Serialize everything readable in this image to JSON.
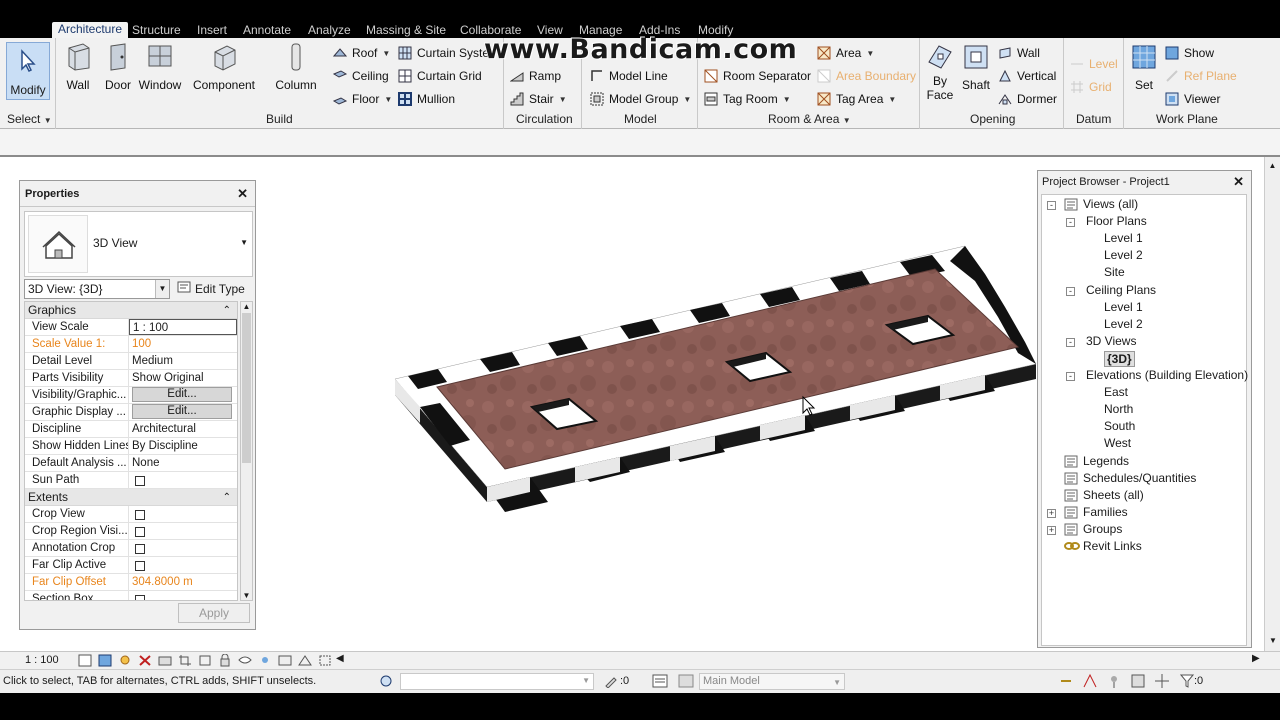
{
  "tabs": [
    "Architecture",
    "Structure",
    "Insert",
    "Annotate",
    "Analyze",
    "Massing & Site",
    "Collaborate",
    "View",
    "Manage",
    "Add-Ins",
    "Modify"
  ],
  "watermark": "www.Bandicam.com",
  "ribbon": {
    "modify": "Modify",
    "select": "Select",
    "build": {
      "label": "Build",
      "wall": "Wall",
      "door": "Door",
      "window": "Window",
      "component": "Component",
      "column": "Column",
      "roof": "Roof",
      "ceiling": "Ceiling",
      "floor": "Floor",
      "curtain_system": "Curtain Syste",
      "curtain_grid": "Curtain Grid",
      "mullion": "Mullion"
    },
    "circulation": {
      "label": "Circulation",
      "ramp": "Ramp",
      "stair": "Stair"
    },
    "model": {
      "label": "Model",
      "model_line": "Model Line",
      "model_group": "Model Group"
    },
    "room_area": {
      "label": "Room & Area",
      "room_separator": "Room Separator",
      "tag_room": "Tag Room",
      "area": "Area",
      "area_boundary": "Area Boundary",
      "tag_area": "Tag Area"
    },
    "opening": {
      "label": "Opening",
      "by_face": "By Face",
      "by": "By",
      "face": "Face",
      "shaft": "Shaft",
      "wall": "Wall",
      "vertical": "Vertical",
      "dormer": "Dormer"
    },
    "datum": {
      "label": "Datum",
      "level": "Level",
      "grid": "Grid"
    },
    "work_plane": {
      "label": "Work Plane",
      "set": "Set",
      "show": "Show",
      "ref_plane": "Ref Plane",
      "viewer": "Viewer"
    }
  },
  "properties": {
    "title": "Properties",
    "type_name": "3D View",
    "instance_selector": "3D View: {3D}",
    "edit_type": "Edit Type",
    "sections": [
      {
        "name": "Graphics",
        "rows": [
          {
            "k": "View Scale",
            "v": "1 : 100",
            "kind": "input"
          },
          {
            "k": "Scale Value    1:",
            "v": "100",
            "kind": "orange"
          },
          {
            "k": "Detail Level",
            "v": "Medium"
          },
          {
            "k": "Parts Visibility",
            "v": "Show Original"
          },
          {
            "k": "Visibility/Graphic...",
            "v": "Edit...",
            "kind": "button"
          },
          {
            "k": "Graphic Display ...",
            "v": "Edit...",
            "kind": "button"
          },
          {
            "k": "Discipline",
            "v": "Architectural"
          },
          {
            "k": "Show Hidden Lines",
            "v": "By Discipline"
          },
          {
            "k": "Default Analysis ...",
            "v": "None"
          },
          {
            "k": "Sun Path",
            "v": "",
            "kind": "check"
          }
        ]
      },
      {
        "name": "Extents",
        "rows": [
          {
            "k": "Crop View",
            "v": "",
            "kind": "check"
          },
          {
            "k": "Crop Region Visi...",
            "v": "",
            "kind": "check"
          },
          {
            "k": "Annotation Crop",
            "v": "",
            "kind": "check"
          },
          {
            "k": "Far Clip Active",
            "v": "",
            "kind": "check"
          },
          {
            "k": "Far Clip Offset",
            "v": "304.8000 m",
            "kind": "orange"
          },
          {
            "k": "Section Box",
            "v": "",
            "kind": "check"
          }
        ]
      }
    ],
    "apply": "Apply"
  },
  "browser": {
    "title": "Project Browser - Project1",
    "nodes": [
      {
        "t": "Views (all)",
        "lvl": 0,
        "pm": "-"
      },
      {
        "t": "Floor Plans",
        "lvl": 1,
        "pm": "-"
      },
      {
        "t": "Level 1",
        "lvl": 2
      },
      {
        "t": "Level 2",
        "lvl": 2
      },
      {
        "t": "Site",
        "lvl": 2
      },
      {
        "t": "Ceiling Plans",
        "lvl": 1,
        "pm": "-"
      },
      {
        "t": "Level 1",
        "lvl": 2
      },
      {
        "t": "Level 2",
        "lvl": 2
      },
      {
        "t": "3D Views",
        "lvl": 1,
        "pm": "-"
      },
      {
        "t": "{3D}",
        "lvl": 2,
        "bold": true
      },
      {
        "t": "Elevations (Building Elevation)",
        "lvl": 1,
        "pm": "-"
      },
      {
        "t": "East",
        "lvl": 2
      },
      {
        "t": "North",
        "lvl": 2
      },
      {
        "t": "South",
        "lvl": 2
      },
      {
        "t": "West",
        "lvl": 2
      },
      {
        "t": "Legends",
        "lvl": 0
      },
      {
        "t": "Schedules/Quantities",
        "lvl": 0
      },
      {
        "t": "Sheets (all)",
        "lvl": 0
      },
      {
        "t": "Families",
        "lvl": 0,
        "pm": "+"
      },
      {
        "t": "Groups",
        "lvl": 0,
        "pm": "+"
      },
      {
        "t": "Revit Links",
        "lvl": 0
      }
    ]
  },
  "viewbar": {
    "scale": "1 : 100"
  },
  "status": {
    "hint": "Click to select, TAB for alternates, CTRL adds, SHIFT unselects.",
    "count": ":0",
    "model": "Main Model",
    "filter": ":0"
  },
  "colors": {
    "accent": "#1d3a6e",
    "orange": "#e8851c",
    "floor": "#8b5a52"
  }
}
